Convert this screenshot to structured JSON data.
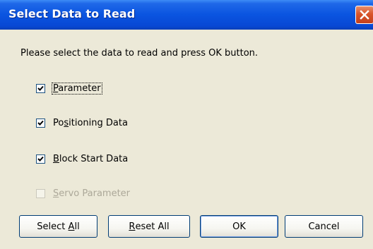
{
  "window": {
    "title": "Select Data to Read"
  },
  "prompt": "Please select the data to read and press OK button.",
  "checkboxes": [
    {
      "label": "Parameter",
      "mnemonic": "P",
      "rest": "arameter",
      "checked": true,
      "enabled": true
    },
    {
      "label": "Positioning Data",
      "mnemonic_pre": "Po",
      "mnemonic": "s",
      "rest": "itioning Data",
      "checked": true,
      "enabled": true
    },
    {
      "label": "Block Start Data",
      "mnemonic": "B",
      "rest": "lock Start Data",
      "checked": true,
      "enabled": true
    },
    {
      "label": "Servo Parameter",
      "mnemonic": "S",
      "rest": "ervo Parameter",
      "checked": false,
      "enabled": false
    }
  ],
  "buttons": {
    "select_all": {
      "label": "Select All",
      "pre": "Select ",
      "mnemonic": "A",
      "rest": "ll"
    },
    "reset_all": {
      "label": "Reset All",
      "pre": "",
      "mnemonic": "R",
      "rest": "eset All"
    },
    "ok": {
      "label": "OK"
    },
    "cancel": {
      "label": "Cancel"
    }
  },
  "colors": {
    "titlebar": "#0a54e0",
    "close_button": "#d8542a",
    "dialog_background": "#ece9d8"
  }
}
